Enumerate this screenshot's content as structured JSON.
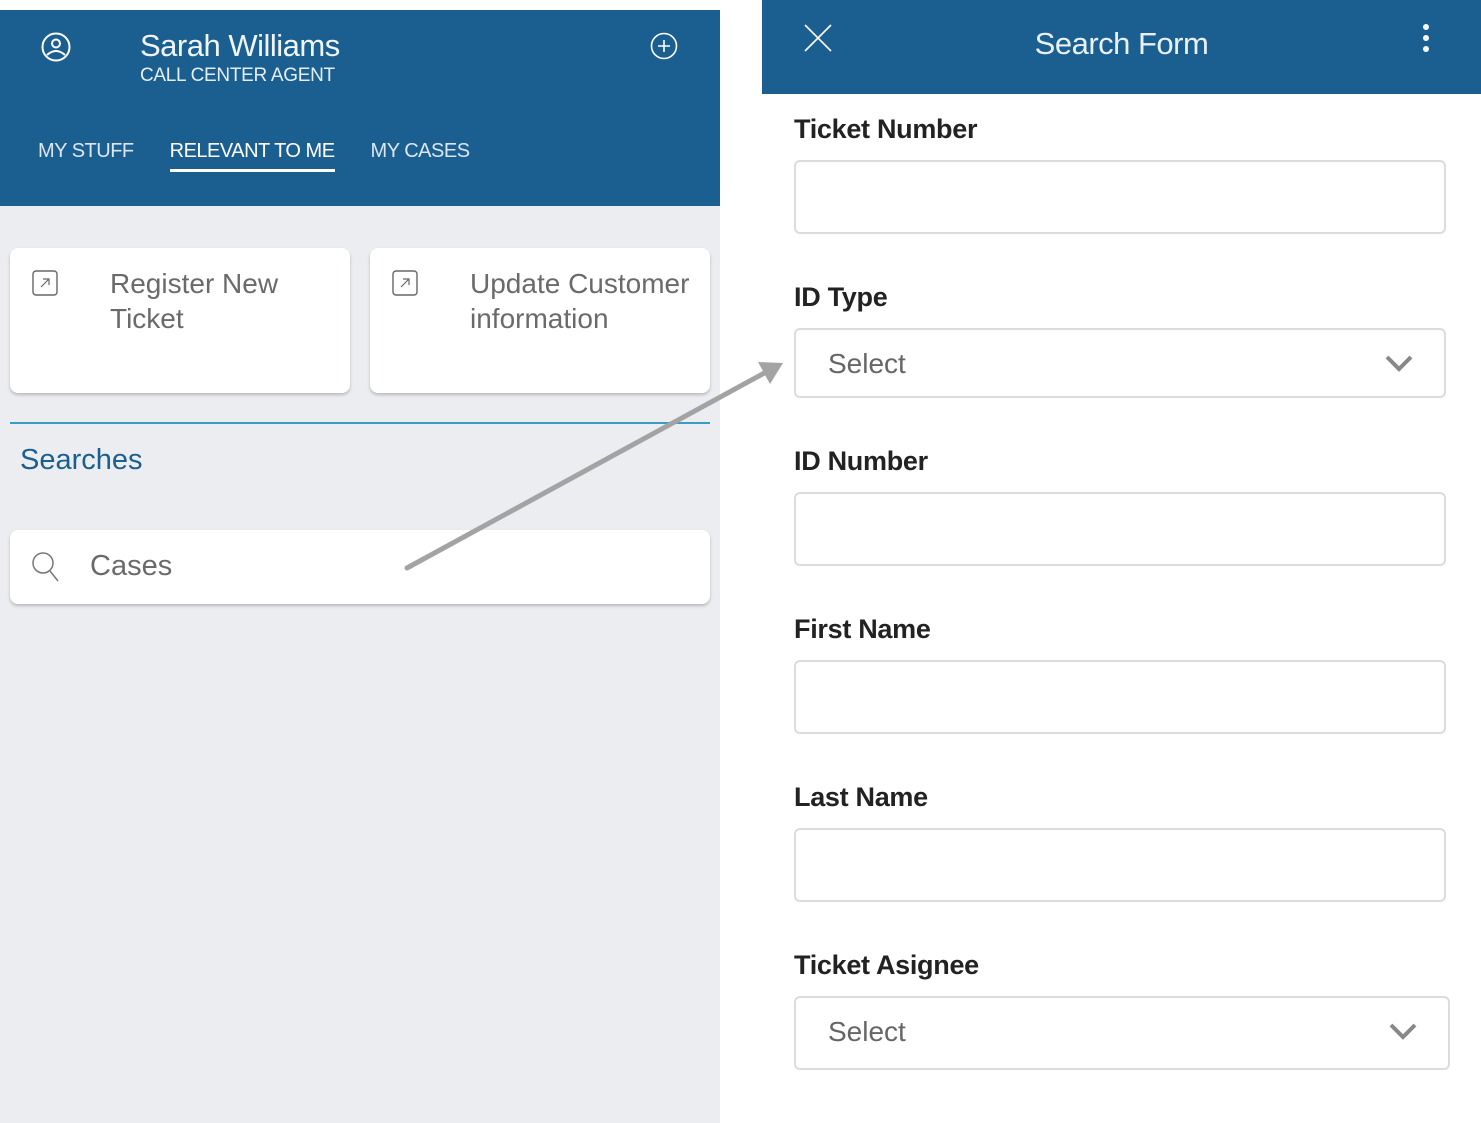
{
  "left_panel": {
    "user": {
      "name": "Sarah Williams",
      "role": "CALL CENTER AGENT"
    },
    "icons": {
      "avatar": "user-circle-icon",
      "add": "plus-circle-icon"
    },
    "tabs": [
      {
        "label": "MY STUFF",
        "active": false
      },
      {
        "label": "RELEVANT TO ME",
        "active": true
      },
      {
        "label": "MY CASES",
        "active": false
      }
    ],
    "actions": [
      {
        "label": "Register New Ticket",
        "icon": "external-link-icon"
      },
      {
        "label": "Update Customer information",
        "icon": "external-link-icon"
      }
    ],
    "section_title": "Searches",
    "searches": [
      {
        "label": "Cases",
        "icon": "search-icon"
      }
    ],
    "colors": {
      "header": "#1b5f91",
      "accent": "#3a9cc4",
      "background": "#ecedf1"
    }
  },
  "right_panel": {
    "title": "Search Form",
    "icons": {
      "close": "close-icon",
      "more": "more-vertical-icon"
    },
    "fields": [
      {
        "label": "Ticket Number",
        "type": "text",
        "value": ""
      },
      {
        "label": "ID Type",
        "type": "select",
        "value": "Select"
      },
      {
        "label": "ID Number",
        "type": "text",
        "value": ""
      },
      {
        "label": "First Name",
        "type": "text",
        "value": ""
      },
      {
        "label": "Last Name",
        "type": "text",
        "value": ""
      },
      {
        "label": "Ticket Asignee",
        "type": "select",
        "value": "Select"
      }
    ]
  },
  "annotation": {
    "type": "arrow",
    "from": "searches.Cases",
    "to": "Search Form"
  }
}
